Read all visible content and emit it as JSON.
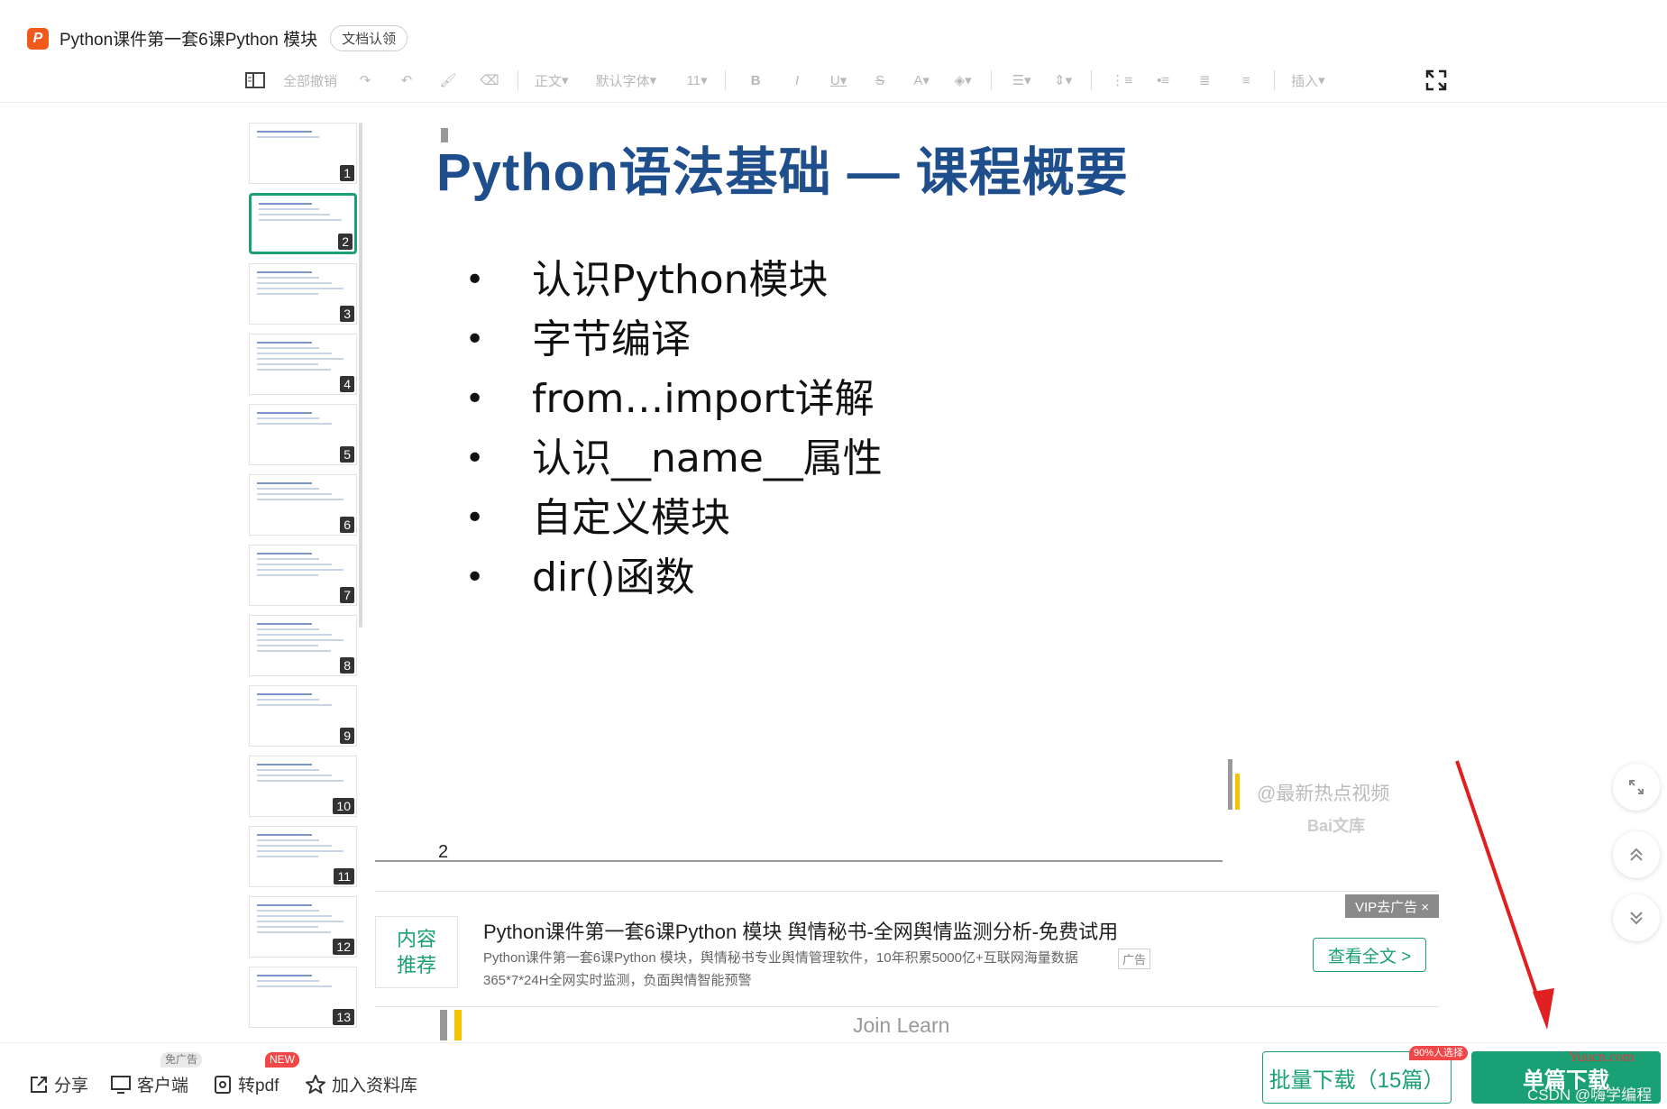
{
  "header": {
    "app_logo_letter": "P",
    "doc_title": "Python课件第一套6课Python 模块",
    "claim_badge": "文档认领"
  },
  "toolbar": {
    "undo_all": "全部撤销",
    "style": "正文",
    "font": "默认字体",
    "size": "11",
    "insert": "插入"
  },
  "thumbnails": [
    {
      "num": "1"
    },
    {
      "num": "2",
      "active": true
    },
    {
      "num": "3"
    },
    {
      "num": "4"
    },
    {
      "num": "5"
    },
    {
      "num": "6"
    },
    {
      "num": "7"
    },
    {
      "num": "8"
    },
    {
      "num": "9"
    },
    {
      "num": "10"
    },
    {
      "num": "11"
    },
    {
      "num": "12"
    },
    {
      "num": "13"
    }
  ],
  "slide": {
    "title": "Python语法基础 — 课程概要",
    "bullets": [
      "认识Python模块",
      "字节编译",
      "from…import详解",
      "认识__name__属性",
      "自定义模块",
      "dir()函数"
    ],
    "page_number": "2",
    "watermark_handle": "@最新热点视频",
    "watermark_logo": "Bai文库"
  },
  "ad": {
    "vip_remove": "VIP去广告 ×",
    "tag_line1": "内容",
    "tag_line2": "推荐",
    "title": "Python课件第一套6课Python 模块  舆情秘书-全网舆情监测分析-免费试用",
    "desc": "Python课件第一套6课Python 模块，舆情秘书专业舆情管理软件，10年积累5000亿+互联网海量数据365*7*24H全网实时监测，负面舆情智能预警",
    "ad_mark": "广告",
    "view_full": "查看全文 >"
  },
  "next_slide": {
    "text": "Join Learn"
  },
  "bottom_bar": {
    "share": "分享",
    "client": "客户端",
    "client_badge": "免广告",
    "to_pdf": "转pdf",
    "to_pdf_badge": "NEW",
    "add_library": "加入资料库",
    "batch_download": "批量下载（15篇）",
    "popular_badge": "90%人选择",
    "single_download": "单篇下载"
  },
  "watermarks": {
    "yuucn": "Yuucn.com",
    "csdn": "CSDN @嗨学编程"
  },
  "colors": {
    "accent": "#1aa075",
    "title_blue": "#1f4e8c",
    "logo_orange": "#f25a1d",
    "arrow_red": "#e02020"
  }
}
